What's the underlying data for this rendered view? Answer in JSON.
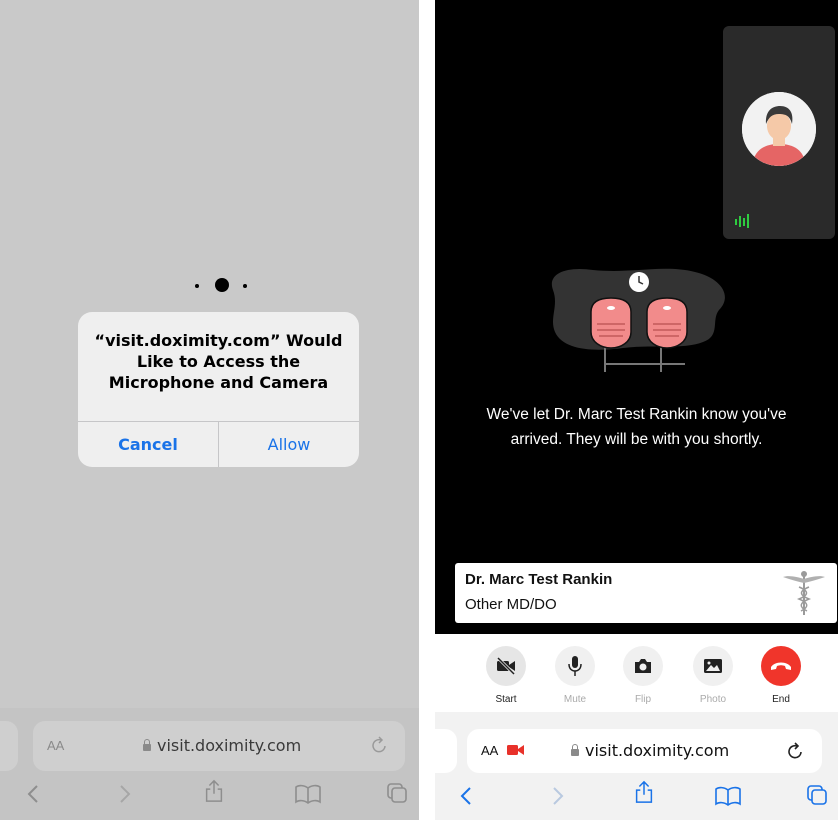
{
  "left_screen": {
    "permission_dialog": {
      "title_line1": "“visit.doximity.com” Would",
      "title_line2": "Like to Access the",
      "title_line3": "Microphone and Camera",
      "cancel_label": "Cancel",
      "allow_label": "Allow"
    },
    "address_bar": {
      "aa_label": "AA",
      "url": "visit.doximity.com"
    },
    "toolbar_icons": [
      "back-icon",
      "forward-icon",
      "share-icon",
      "bookmarks-icon",
      "tabs-icon"
    ]
  },
  "right_screen": {
    "waiting_message_line1": "We've let Dr. Marc Test Rankin know you've",
    "waiting_message_line2": "arrived. They will be with you shortly.",
    "doctor_card": {
      "name": "Dr. Marc Test Rankin",
      "specialty": "Other MD/DO"
    },
    "controls": [
      {
        "icon": "video-off-icon",
        "label": "Start",
        "dim": false
      },
      {
        "icon": "microphone-icon",
        "label": "Mute",
        "dim": true
      },
      {
        "icon": "camera-flip-icon",
        "label": "Flip",
        "dim": true
      },
      {
        "icon": "photo-icon",
        "label": "Photo",
        "dim": true
      },
      {
        "icon": "end-call-icon",
        "label": "End",
        "dim": false
      }
    ],
    "address_bar": {
      "aa_label": "AA",
      "url": "visit.doximity.com"
    },
    "toolbar_icons": [
      "back-icon",
      "forward-icon",
      "share-icon",
      "bookmarks-icon",
      "tabs-icon"
    ]
  },
  "colors": {
    "ios_blue": "#1a73e8",
    "end_call_red": "#f0352b",
    "speaking_green": "#2ecc40",
    "chair_pink": "#f28b8b"
  }
}
